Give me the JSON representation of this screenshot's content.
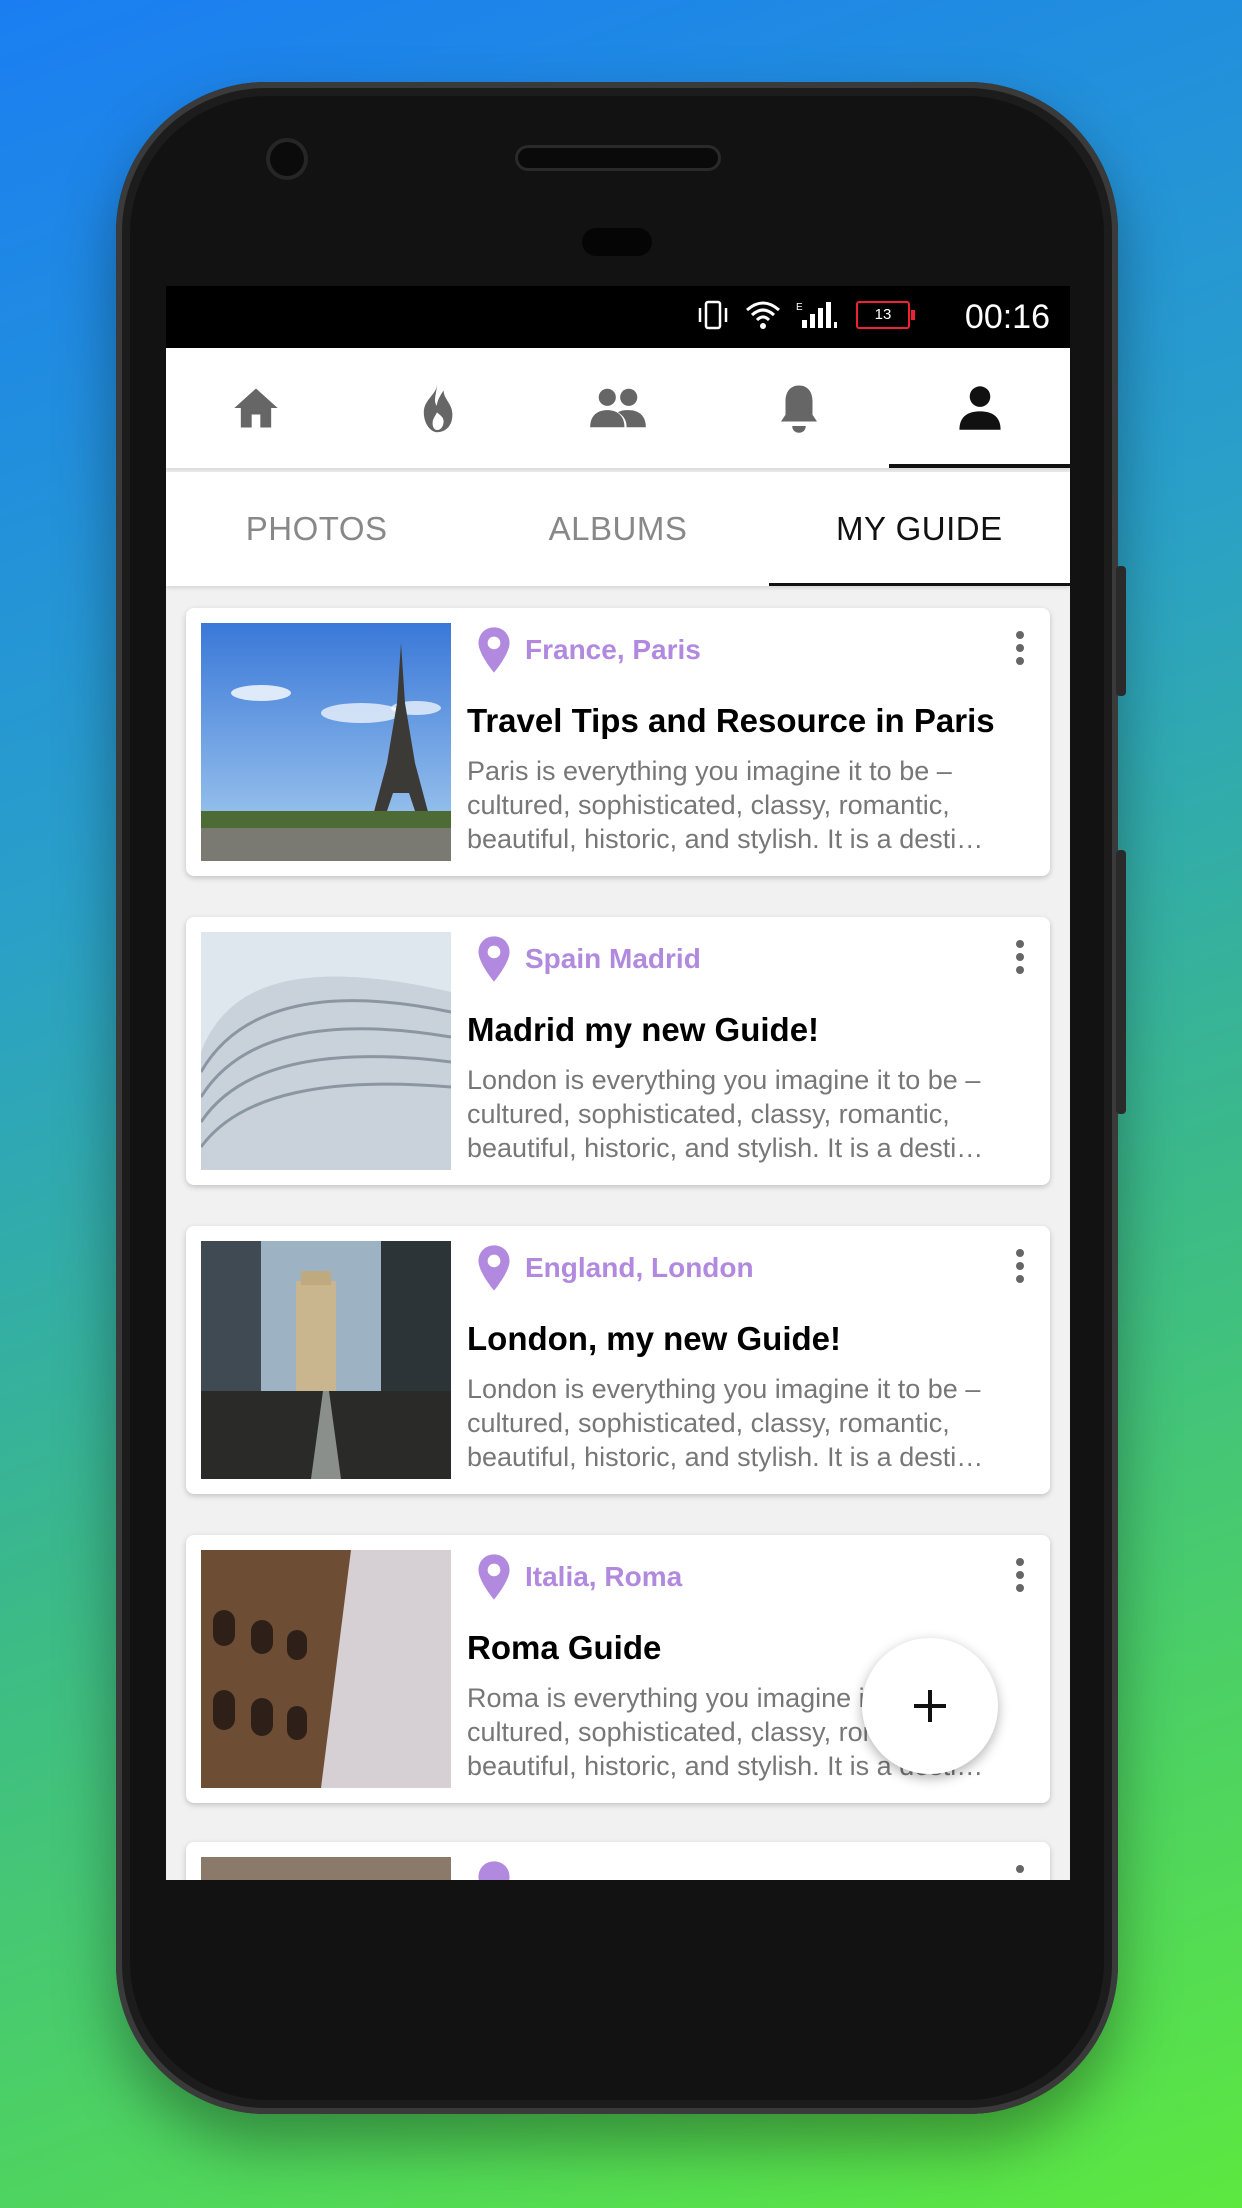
{
  "status": {
    "time": "00:16",
    "battery": "13"
  },
  "nav": {
    "items": [
      {
        "icon": "home-icon",
        "active": false
      },
      {
        "icon": "fire-icon",
        "active": false
      },
      {
        "icon": "people-icon",
        "active": false
      },
      {
        "icon": "bell-icon",
        "active": false
      },
      {
        "icon": "profile-icon",
        "active": true
      }
    ]
  },
  "tabs": [
    {
      "label": "PHOTOS",
      "active": false
    },
    {
      "label": "ALBUMS",
      "active": false
    },
    {
      "label": "MY GUIDE",
      "active": true
    }
  ],
  "guides": [
    {
      "location": "France, Paris",
      "title": "Travel Tips and Resource in Paris",
      "description": "Paris is everything you imagine it to be – cultured, sophisticated, classy, romantic, beautiful, historic, and stylish. It is a desti…",
      "image": "eiffel-tower-photo"
    },
    {
      "location": "Spain Madrid",
      "title": "Madrid my new Guide!",
      "description": "London is everything you imagine it to be – cultured, sophisticated, classy, romantic, beautiful, historic, and stylish. It is a desti…",
      "image": "madrid-building-photo"
    },
    {
      "location": "England, London",
      "title": "London, my new Guide!",
      "description": "London is everything you imagine it to be – cultured, sophisticated, classy, romantic, beautiful, historic, and stylish. It is a desti…",
      "image": "tower-bridge-photo"
    },
    {
      "location": "Italia, Roma",
      "title": "Roma Guide",
      "description": "Roma is everything you imagine it to be – cultured, sophisticated, classy, romantic, beautiful, historic, and stylish. It is a desti…",
      "image": "colosseum-photo"
    }
  ],
  "fab": {
    "label": "+",
    "icon": "add-icon"
  },
  "colors": {
    "accent": "#b18ae0",
    "active": "#111111",
    "inactive": "#888888"
  }
}
